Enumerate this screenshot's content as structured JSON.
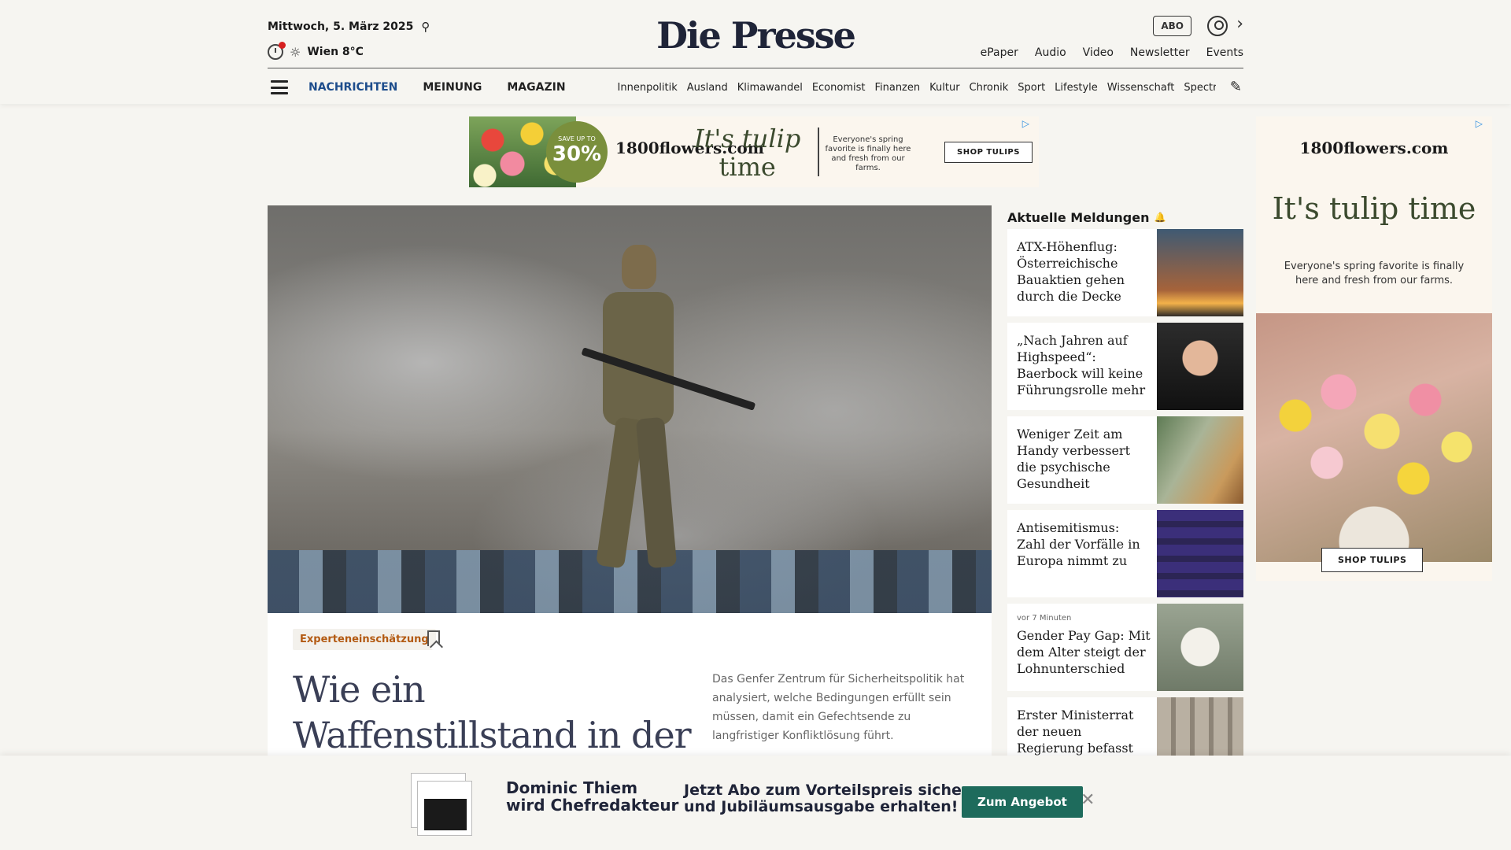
{
  "header": {
    "date": "Mittwoch, 5. März 2025",
    "weather": "Wien 8°C",
    "logo": "Die Presse",
    "abo": "ABO",
    "links": [
      "ePaper",
      "Audio",
      "Video",
      "Newsletter",
      "Events"
    ]
  },
  "nav": {
    "main": [
      "NACHRICHTEN",
      "MEINUNG",
      "MAGAZIN"
    ],
    "sub": [
      "Innenpolitik",
      "Ausland",
      "Klimawandel",
      "Economist",
      "Finanzen",
      "Kultur",
      "Chronik",
      "Sport",
      "Lifestyle",
      "Wissenschaft",
      "Spectrum"
    ]
  },
  "ad_top": {
    "badge_small": "SAVE UP TO",
    "badge_big": "30%",
    "brand": "1800flowers.com",
    "headline_a": "It's tulip",
    "headline_b": "time",
    "copy": "Everyone's spring favorite is finally here and fresh from our farms.",
    "cta": "SHOP TULIPS"
  },
  "ad_side": {
    "brand": "1800flowers.com",
    "headline": "It's tulip time",
    "copy": "Everyone's spring favorite is finally here and fresh from our farms.",
    "cta": "SHOP TULIPS"
  },
  "hero": {
    "tag": "Experteneinschätzung",
    "title": "Wie ein Waffenstillstand in der Ukraine",
    "teaser": "Das Genfer Zentrum für Sicherheitspolitik hat analysiert, welche Bedingungen erfüllt sein müssen, damit ein Gefechtsende zu langfristiger Konfliktlösung führt."
  },
  "news": {
    "heading": "Aktuelle Meldungen",
    "items": [
      {
        "title": "ATX-Höhenflug: Österreichische Bauaktien gehen durch die Decke",
        "time": ""
      },
      {
        "title": "„Nach Jahren auf Highspeed“: Baerbock will keine Führungsrolle mehr",
        "time": ""
      },
      {
        "title": "Weniger Zeit am Handy verbessert die psychische Gesundheit",
        "time": ""
      },
      {
        "title": "Antisemitismus: Zahl der Vorfälle in Europa nimmt zu",
        "time": ""
      },
      {
        "title": "Gender Pay Gap: Mit dem Alter steigt der Lohnunterschied",
        "time": "vor 7 Minuten"
      },
      {
        "title": "Erster Ministerrat der neuen Regierung befasst",
        "time": ""
      }
    ]
  },
  "promo": {
    "name_a": "Dominic Thiem",
    "name_b": "wird Chefredakteur",
    "text_a": "Jetzt Abo zum Vorteilspreis sichern",
    "text_b": "und Jubiläumsausgabe erhalten!",
    "cta": "Zum Angebot"
  },
  "colors": {
    "accent_nav": "#1e4d8c",
    "tag": "#b35a12",
    "promo_button": "#1e6b5c",
    "notification": "#d62020"
  }
}
